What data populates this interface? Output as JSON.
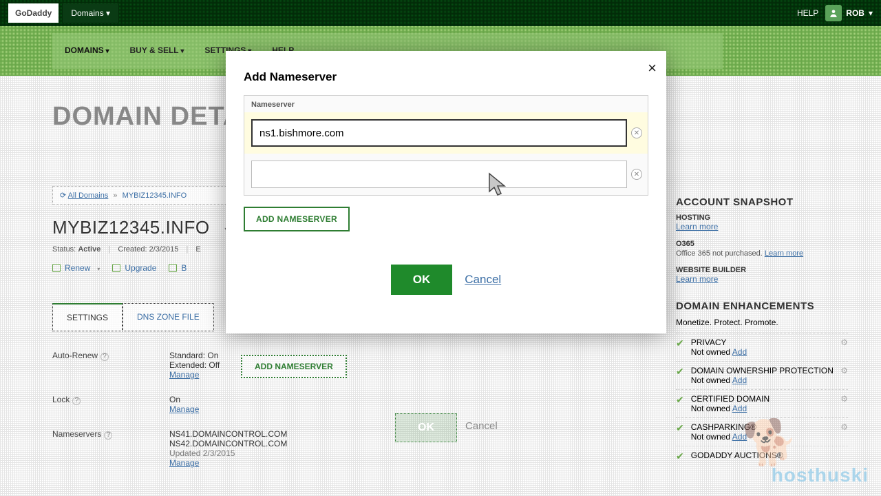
{
  "topbar": {
    "brand": "GoDaddy",
    "nav1": "Domains ▾",
    "help": "HELP",
    "user": "ROB"
  },
  "subnav": {
    "tab_domains": "DOMAINS",
    "tab_buysell": "BUY & SELL",
    "tab_settings": "SETTINGS",
    "tab_help": "HELP"
  },
  "hero": {
    "title": "DOMAIN DETAILS"
  },
  "breadcrumb": {
    "all": "All Domains",
    "current": "MYBIZ12345.INFO"
  },
  "domain": {
    "name": "MYBIZ12345.INFO",
    "status_label": "Status:",
    "status_val": "Active",
    "created_label": "Created:",
    "created_val": "2/3/2015",
    "expires_label": "E"
  },
  "actions": {
    "renew": "Renew",
    "upgrade": "Upgrade",
    "buy": "B"
  },
  "tabs": {
    "settings": "SETTINGS",
    "dns": "DNS ZONE FILE"
  },
  "settings": {
    "autorenew_label": "Auto-Renew",
    "autorenew_std": "Standard: On",
    "autorenew_ext": "Extended: Off",
    "manage": "Manage",
    "lock_label": "Lock",
    "lock_val": "On",
    "ns_label": "Nameservers",
    "ns1": "NS41.DOMAINCONTROL.COM",
    "ns2": "NS42.DOMAINCONTROL.COM",
    "ns_updated": "Updated 2/3/2015"
  },
  "bgbuttons": {
    "add": "ADD NAMESERVER",
    "ok": "OK",
    "cancel": "Cancel"
  },
  "sidebar": {
    "snapshot_title": "ACCOUNT SNAPSHOT",
    "hosting_title": "HOSTING",
    "learn_more": "Learn more",
    "o365_title": "O365",
    "o365_sub": "Office 365 not purchased.",
    "wb_title": "WEBSITE BUILDER",
    "enh_title": "DOMAIN ENHANCEMENTS",
    "enh_sub": "Monetize. Protect. Promote.",
    "items": [
      {
        "name": "PRIVACY",
        "sub": "Not owned",
        "add": "Add"
      },
      {
        "name": "DOMAIN OWNERSHIP PROTECTION",
        "sub": "Not owned",
        "add": "Add"
      },
      {
        "name": "CERTIFIED DOMAIN",
        "sub": "Not owned",
        "add": "Add"
      },
      {
        "name": "CASHPARKING®",
        "sub": "Not owned",
        "add": "Add"
      },
      {
        "name": "GODADDY AUCTIONS®",
        "sub": "",
        "add": ""
      }
    ]
  },
  "modal": {
    "title": "Add Nameserver",
    "field_label": "Nameserver",
    "inputs": {
      "ns1": "ns1.bishmore.com",
      "ns2": ""
    },
    "add_btn": "ADD NAMESERVER",
    "ok": "OK",
    "cancel": "Cancel"
  },
  "watermark": {
    "text": "hosthuski"
  }
}
